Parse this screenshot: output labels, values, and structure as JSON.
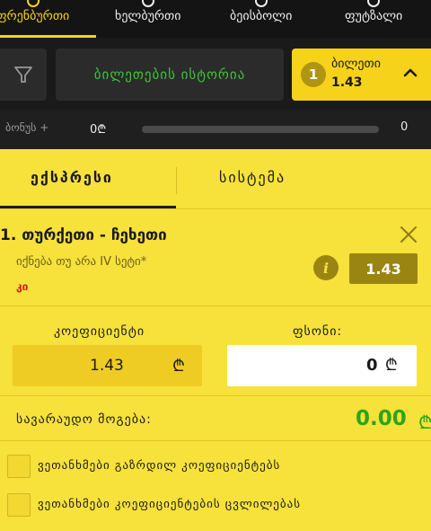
{
  "sport_tabs": [
    {
      "label": "ფრენბურთი",
      "active": true
    },
    {
      "label": "ხელბურთი",
      "active": false
    },
    {
      "label": "ბეისბოლი",
      "active": false
    },
    {
      "label": "ფუტზალი",
      "active": false
    }
  ],
  "controls": {
    "filter_icon": "filter-icon",
    "history_label": "ბილეთების ისტორია",
    "betslip": {
      "count": "1",
      "title": "ბილეთი",
      "odds": "1.43",
      "chevron_icon": "chevron-up-icon"
    }
  },
  "bonus": {
    "label": "ბონუს +",
    "value": "0₾",
    "max": "0",
    "progress_fraction": 0
  },
  "bet_modes": [
    {
      "label": "ექსპრესი",
      "active": true
    },
    {
      "label": "სისტემა",
      "active": false
    }
  ],
  "event": {
    "title": "1. თურქეთი - ჩეხეთი",
    "market": "იქნება თუ არა IV სეტი*",
    "selection": "კი",
    "odds": "1.43",
    "info_icon": "info-icon",
    "close_icon": "close-icon"
  },
  "coefficient": {
    "label": "კოეფიციენტი",
    "value": "1.43",
    "currency": "₾"
  },
  "stake": {
    "label": "ფსონი:",
    "value": "0",
    "currency": "₾"
  },
  "potential_win": {
    "label": "სავარაუდო მოგება:",
    "value": "0.00",
    "currency": "₾"
  },
  "checkboxes": [
    {
      "label": "ვეთანხმები გაზრდილ კოეფიციენტებს",
      "checked": false
    },
    {
      "label": "ვეთანხმები კოეფიციენტების ცვლილებას",
      "checked": false
    }
  ],
  "colors": {
    "accent": "#f7d21a",
    "panel": "#f7e13b",
    "green": "#2aa51c",
    "dark": "#1a1a1a"
  }
}
